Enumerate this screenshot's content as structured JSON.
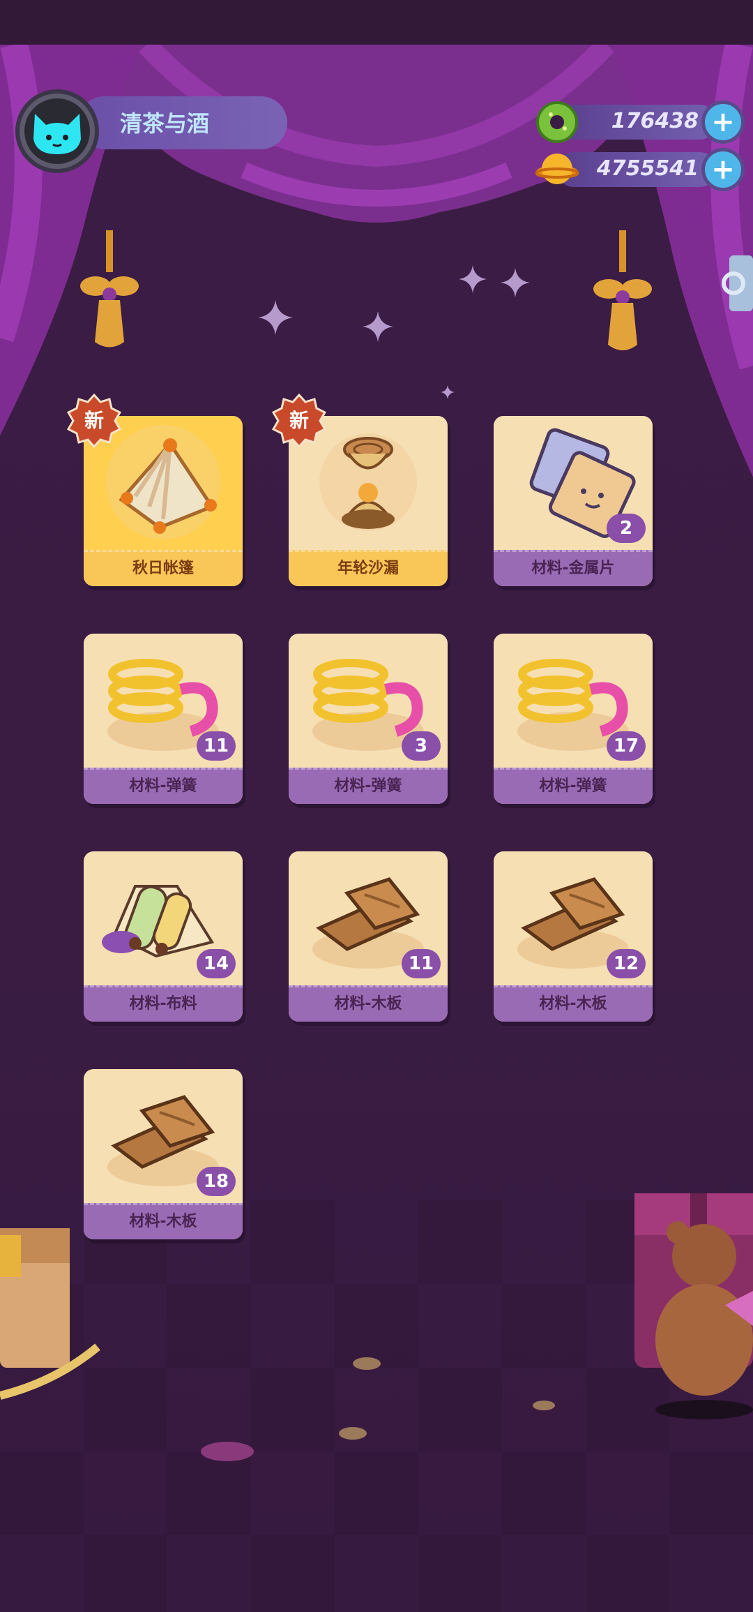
{
  "profile": {
    "name": "清茶与酒"
  },
  "currencies": [
    {
      "icon": "green-donut-coin-icon",
      "value": "176438"
    },
    {
      "icon": "orange-planet-coin-icon",
      "value": "4755541"
    }
  ],
  "new_tag_label": "新",
  "items": [
    {
      "label": "秋日帐篷",
      "count": "",
      "is_new": true,
      "art": "tent"
    },
    {
      "label": "年轮沙漏",
      "count": "",
      "is_new": true,
      "art": "hourglass"
    },
    {
      "label": "材料-金属片",
      "count": "2",
      "is_new": false,
      "art": "metal"
    },
    {
      "label": "材料-弹簧",
      "count": "11",
      "is_new": false,
      "art": "spring"
    },
    {
      "label": "材料-弹簧",
      "count": "3",
      "is_new": false,
      "art": "spring"
    },
    {
      "label": "材料-弹簧",
      "count": "17",
      "is_new": false,
      "art": "spring"
    },
    {
      "label": "材料-布料",
      "count": "14",
      "is_new": false,
      "art": "cloth"
    },
    {
      "label": "材料-木板",
      "count": "11",
      "is_new": false,
      "art": "wood"
    },
    {
      "label": "材料-木板",
      "count": "12",
      "is_new": false,
      "art": "wood"
    },
    {
      "label": "材料-木板",
      "count": "18",
      "is_new": false,
      "art": "wood"
    }
  ],
  "colors": {
    "accent_plus": "#4fb6ea",
    "label_bar": "#9a6bb5",
    "new_card": "#ffcf50"
  }
}
